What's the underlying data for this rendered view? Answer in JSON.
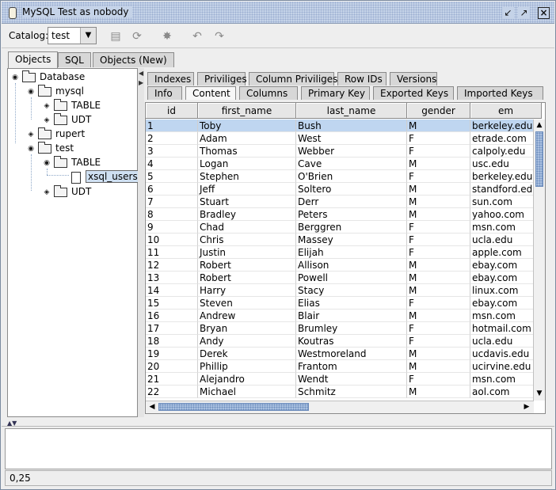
{
  "window": {
    "title": "MySQL Test as nobody",
    "buttons": [
      "minimize",
      "maximize",
      "close"
    ]
  },
  "toolbar": {
    "catalog_label": "Catalog:",
    "catalog_value": "test",
    "icons": [
      "query-icon",
      "refresh-icon",
      "run-icon",
      "undo-icon",
      "redo-icon"
    ]
  },
  "left_tabs": [
    {
      "label": "Objects",
      "active": true
    },
    {
      "label": "SQL",
      "active": false
    },
    {
      "label": "Objects (New)",
      "active": false
    }
  ],
  "tree": {
    "nodes": [
      {
        "label": "Database",
        "expanded": true
      },
      {
        "label": "mysql",
        "expanded": true
      },
      {
        "label": "TABLE",
        "expanded": false
      },
      {
        "label": "UDT",
        "expanded": false
      },
      {
        "label": "rupert",
        "expanded": false
      },
      {
        "label": "test",
        "expanded": true
      },
      {
        "label": "TABLE",
        "expanded": true
      },
      {
        "label": "xsql_users",
        "selected": true
      },
      {
        "label": "UDT",
        "expanded": false
      }
    ]
  },
  "right_tabs_row1": [
    "Indexes",
    "Priviliges",
    "Column Priviliges",
    "Row IDs",
    "Versions"
  ],
  "right_tabs_row2": [
    "Info",
    "Content",
    "Columns",
    "Primary Key",
    "Exported Keys",
    "Imported Keys"
  ],
  "active_right_tab": "Content",
  "grid": {
    "columns": [
      "id",
      "first_name",
      "last_name",
      "gender",
      "em"
    ],
    "rows": [
      [
        "1",
        "Toby",
        "Bush",
        "M",
        "berkeley.edu"
      ],
      [
        "2",
        "Adam",
        "West",
        "F",
        "etrade.com"
      ],
      [
        "3",
        "Thomas",
        "Webber",
        "F",
        "calpoly.edu"
      ],
      [
        "4",
        "Logan",
        "Cave",
        "M",
        "usc.edu"
      ],
      [
        "5",
        "Stephen",
        "O'Brien",
        "F",
        "berkeley.edu"
      ],
      [
        "6",
        "Jeff",
        "Soltero",
        "M",
        "standford.edu"
      ],
      [
        "7",
        "Stuart",
        "Derr",
        "M",
        "sun.com"
      ],
      [
        "8",
        "Bradley",
        "Peters",
        "M",
        "yahoo.com"
      ],
      [
        "9",
        "Chad",
        "Berggren",
        "F",
        "msn.com"
      ],
      [
        "10",
        "Chris",
        "Massey",
        "F",
        "ucla.edu"
      ],
      [
        "11",
        "Justin",
        "Elijah",
        "F",
        "apple.com"
      ],
      [
        "12",
        "Robert",
        "Allison",
        "M",
        "ebay.com"
      ],
      [
        "13",
        "Robert",
        "Powell",
        "M",
        "ebay.com"
      ],
      [
        "14",
        "Harry",
        "Stacy",
        "M",
        "linux.com"
      ],
      [
        "15",
        "Steven",
        "Elias",
        "F",
        "ebay.com"
      ],
      [
        "16",
        "Andrew",
        "Blair",
        "M",
        "msn.com"
      ],
      [
        "17",
        "Bryan",
        "Brumley",
        "F",
        "hotmail.com"
      ],
      [
        "18",
        "Andy",
        "Koutras",
        "F",
        "ucla.edu"
      ],
      [
        "19",
        "Derek",
        "Westmoreland",
        "M",
        "ucdavis.edu"
      ],
      [
        "20",
        "Phillip",
        "Frantom",
        "M",
        "ucirvine.edu"
      ],
      [
        "21",
        "Alejandro",
        "Wendt",
        "F",
        "msn.com"
      ],
      [
        "22",
        "Michael",
        "Schmitz",
        "M",
        "aol.com"
      ]
    ],
    "selected_row": 0
  },
  "status": {
    "position": "0,25"
  },
  "colors": {
    "selection": "#bfd6f0",
    "titlebar": "#c5d3e8",
    "scroll_thumb": "#a9c0e0"
  }
}
